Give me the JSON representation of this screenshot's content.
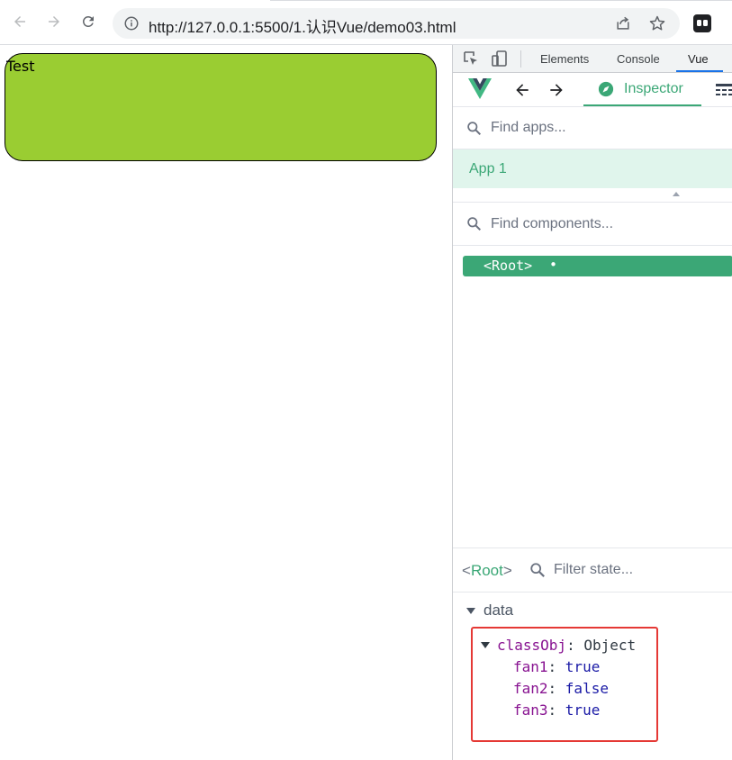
{
  "browser": {
    "url": "http://127.0.0.1:5500/1.认识Vue/demo03.html"
  },
  "page": {
    "test_text": "Test",
    "box_color": "#9acd32"
  },
  "devtools": {
    "tabs": [
      "Elements",
      "Console",
      "Vue"
    ],
    "active_tab": "Vue",
    "vue": {
      "inspector_label": "Inspector",
      "find_apps_placeholder": "Find apps...",
      "app_name": "App 1",
      "find_components_placeholder": "Find components...",
      "tree_root": "<Root>",
      "tree_root_dot": "•",
      "state_root": "Root",
      "filter_placeholder": "Filter state...",
      "section": "data",
      "object": {
        "key": "classObj",
        "type": "Object",
        "props": [
          {
            "key": "fan1",
            "value": "true"
          },
          {
            "key": "fan2",
            "value": "false"
          },
          {
            "key": "fan3",
            "value": "true"
          }
        ]
      },
      "accent_color": "#3ba776"
    }
  }
}
